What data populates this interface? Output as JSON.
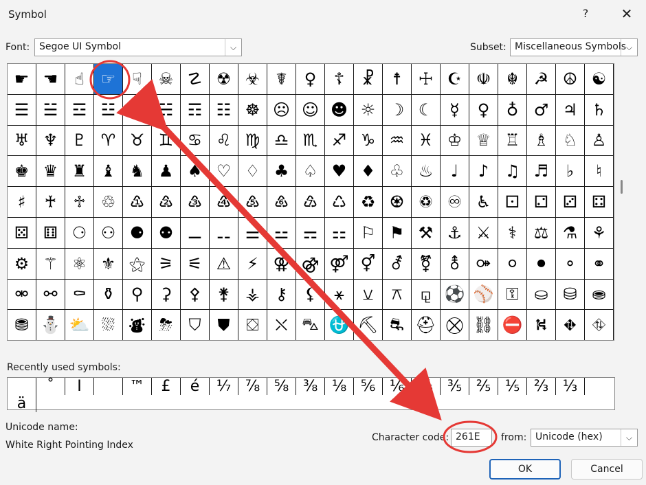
{
  "window": {
    "title": "Symbol",
    "help_glyph": "?",
    "close_glyph": "✕"
  },
  "font": {
    "label": "Font:",
    "value": "Segoe UI Symbol"
  },
  "subset": {
    "label": "Subset:",
    "value": "Miscellaneous Symbols"
  },
  "symbol_grid": {
    "selected_index": 3,
    "cells": [
      "☛",
      "☚",
      "☝",
      "☞",
      "☟",
      "☠",
      "☡",
      "☢",
      "☣",
      "☤",
      "♀",
      "☦",
      "☧",
      "☨",
      "☩",
      "☪",
      "☫",
      "☬",
      "☭",
      "☮",
      "☯",
      "☰",
      "☱",
      "☲",
      "☳",
      "☴",
      "☵",
      "☶",
      "☷",
      "☸",
      "☹",
      "☺",
      "☻",
      "☼",
      "☽",
      "☾",
      "☿",
      "♀",
      "♁",
      "♂",
      "♃",
      "♄",
      "♅",
      "♆",
      "♇",
      "♈",
      "♉",
      "♊",
      "♋",
      "♌",
      "♍",
      "♎",
      "♏",
      "♐",
      "♑",
      "♒",
      "♓",
      "♔",
      "♕",
      "♖",
      "♗",
      "♘",
      "♙",
      "♚",
      "♛",
      "♜",
      "♝",
      "♞",
      "♟",
      "♠",
      "♡",
      "♢",
      "♣",
      "♤",
      "♥",
      "♦",
      "♧",
      "♨",
      "♩",
      "♪",
      "♫",
      "♬",
      "♭",
      "♮",
      "♯",
      "♰",
      "♱",
      "♲",
      "♳",
      "♴",
      "♵",
      "♶",
      "♷",
      "♸",
      "♹",
      "♺",
      "♻",
      "♼",
      "♽",
      "♾",
      "♿",
      "⚀",
      "⚁",
      "⚂",
      "⚃",
      "⚄",
      "⚅",
      "⚆",
      "⚇",
      "⚈",
      "⚉",
      "⚊",
      "⚋",
      "⚌",
      "⚍",
      "⚎",
      "⚏",
      "⚐",
      "⚑",
      "⚒",
      "⚓",
      "⚔",
      "⚕",
      "⚖",
      "⚗",
      "⚘",
      "⚙",
      "⚚",
      "⚛",
      "⚜",
      "⚝",
      "⚞",
      "⚟",
      "⚠",
      "⚡",
      "⚢",
      "⚣",
      "⚤",
      "⚥",
      "⚦",
      "⚧",
      "⚨",
      "⚩",
      "⚪",
      "⚫",
      "⚬",
      "⚭",
      "⚮",
      "⚯",
      "⚰",
      "⚱",
      "⚲",
      "⚳",
      "⚴",
      "⚵",
      "⚶",
      "⚷",
      "⚸",
      "⚹",
      "⚺",
      "⚻",
      "⚼",
      "⚽",
      "⚾",
      "⚿",
      "⛀",
      "⛁",
      "⛂",
      "⛃",
      "⛄",
      "⛅",
      "⛆",
      "⛇",
      "⛈",
      "⛉",
      "⛊",
      "⛋",
      "⛌",
      "⛍",
      "⛎",
      "⛏",
      "⛐",
      "⛑",
      "⛒",
      "⛓",
      "⛔",
      "⛕",
      "⛖",
      "⛗"
    ]
  },
  "recent": {
    "label": "Recently used symbols:",
    "symbols": [
      "",
      "˚",
      "I",
      "",
      "™",
      "£",
      "é",
      "⅐",
      "⅞",
      "⅝",
      "⅜",
      "⅛",
      "⅚",
      "⅙",
      "⅘",
      "⅗",
      "⅖",
      "⅕",
      "⅔",
      "⅓",
      "ä"
    ]
  },
  "unicode_name": {
    "label": "Unicode name:",
    "value": "White Right Pointing Index"
  },
  "character_code": {
    "label": "Character code:",
    "value": "261E"
  },
  "from": {
    "label": "from:",
    "value": "Unicode (hex)"
  },
  "buttons": {
    "ok": "OK",
    "cancel": "Cancel"
  },
  "annotation": {
    "color": "#e53935"
  }
}
